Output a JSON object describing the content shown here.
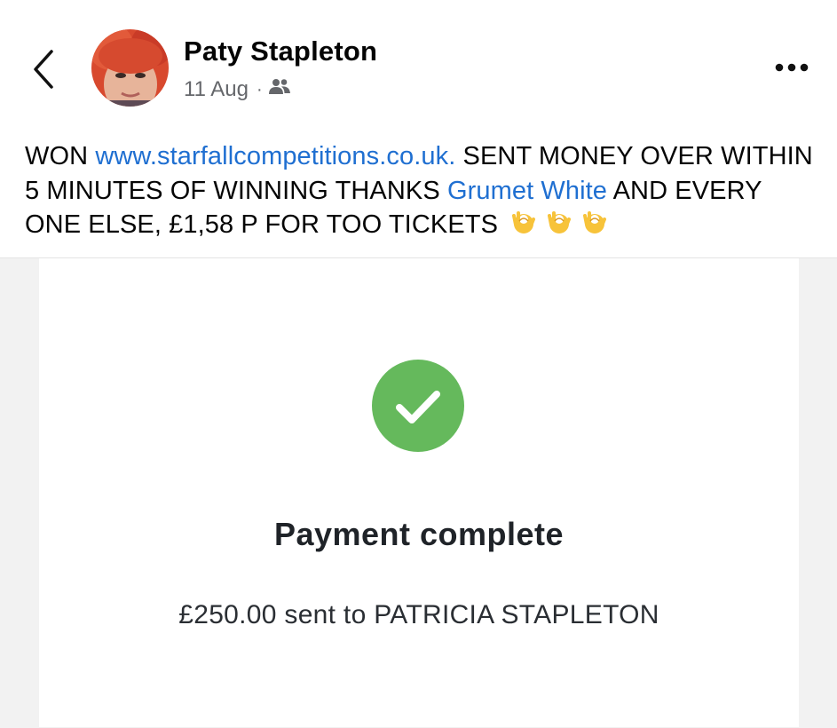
{
  "post": {
    "author": "Paty Stapleton",
    "date": "11 Aug",
    "separator": "·",
    "audience_icon": "friends-icon",
    "text_part1": "WON ",
    "link_text": "www.starfallcompetitions.co.uk.",
    "text_part2": " SENT MONEY OVER WITHIN 5 MINUTES OF WINNING THANKS ",
    "mention": "Grumet White",
    "text_part3": " AND EVERY ONE ELSE, £1,58 P FOR TOO TICKETS",
    "emojis": [
      "ok-hand-emoji",
      "ok-hand-emoji",
      "ok-hand-emoji"
    ]
  },
  "payment": {
    "title": "Payment complete",
    "subtitle": "£250.00 sent to PATRICIA STAPLETON",
    "status_icon": "check-circle-icon"
  },
  "colors": {
    "link": "#1f6fd1",
    "success": "#65b95c",
    "text": "#050505",
    "muted": "#65676b"
  }
}
